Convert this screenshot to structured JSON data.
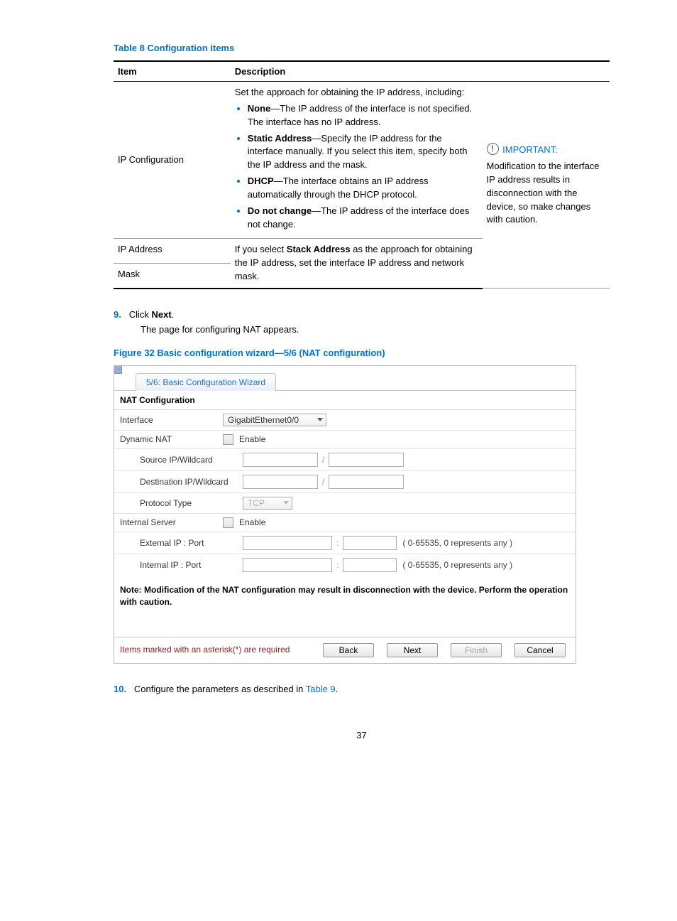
{
  "table8": {
    "caption": "Table 8 Configuration items",
    "head_item": "Item",
    "head_desc": "Description",
    "rows": {
      "ipcfg": {
        "label": "IP Configuration",
        "intro": "Set the approach for obtaining the IP address, including:",
        "bullets": {
          "none_b": "None",
          "none_t": "—The IP address of the interface is not specified. The interface has no IP address.",
          "static_b": "Static Address",
          "static_t": "—Specify the IP address for the interface manually. If you select this item, specify both the IP address and the mask.",
          "dhcp_b": "DHCP",
          "dhcp_t": "—The interface obtains an IP address automatically through the DHCP protocol.",
          "nochg_b": "Do not change",
          "nochg_t": "—The IP address of the interface does not change."
        }
      },
      "ipaddr_label": "IP Address",
      "mask_label": "Mask",
      "ipmask_desc_a": "If you select ",
      "ipmask_desc_b": "Stack Address",
      "ipmask_desc_c": " as the approach for obtaining the IP address, set the interface IP address and network mask."
    },
    "important": {
      "head": "IMPORTANT:",
      "body": "Modification to the interface IP address results in disconnection with the device, so make changes with caution."
    }
  },
  "step9": {
    "num": "9.",
    "line_a": "Click ",
    "line_b": "Next",
    "line_c": ".",
    "body": "The page for configuring NAT appears."
  },
  "figure32": {
    "caption": "Figure 32 Basic configuration wizard—5/6 (NAT configuration)",
    "tab": "5/6: Basic Configuration Wizard",
    "section": "NAT Configuration",
    "rows": {
      "iface_lbl": "Interface",
      "iface_val": "GigabitEthernet0/0",
      "dyn_lbl": "Dynamic NAT",
      "enable": "Enable",
      "srcip_lbl": "Source IP/Wildcard",
      "dstip_lbl": "Destination IP/Wildcard",
      "proto_lbl": "Protocol Type",
      "proto_val": "TCP",
      "intsrv_lbl": "Internal Server",
      "ext_lbl": "External IP : Port",
      "int_lbl": "Internal IP : Port",
      "range_hint": "( 0-65535, 0 represents any )"
    },
    "note": "Note: Modification of the NAT configuration may result in disconnection with the device. Perform the operation with caution.",
    "req": "Items marked with an asterisk(*) are required",
    "btn_back": "Back",
    "btn_next": "Next",
    "btn_finish": "Finish",
    "btn_cancel": "Cancel"
  },
  "step10": {
    "num": "10.",
    "text_a": "Configure the parameters as described in ",
    "link": "Table 9",
    "text_b": "."
  },
  "page_num": "37"
}
